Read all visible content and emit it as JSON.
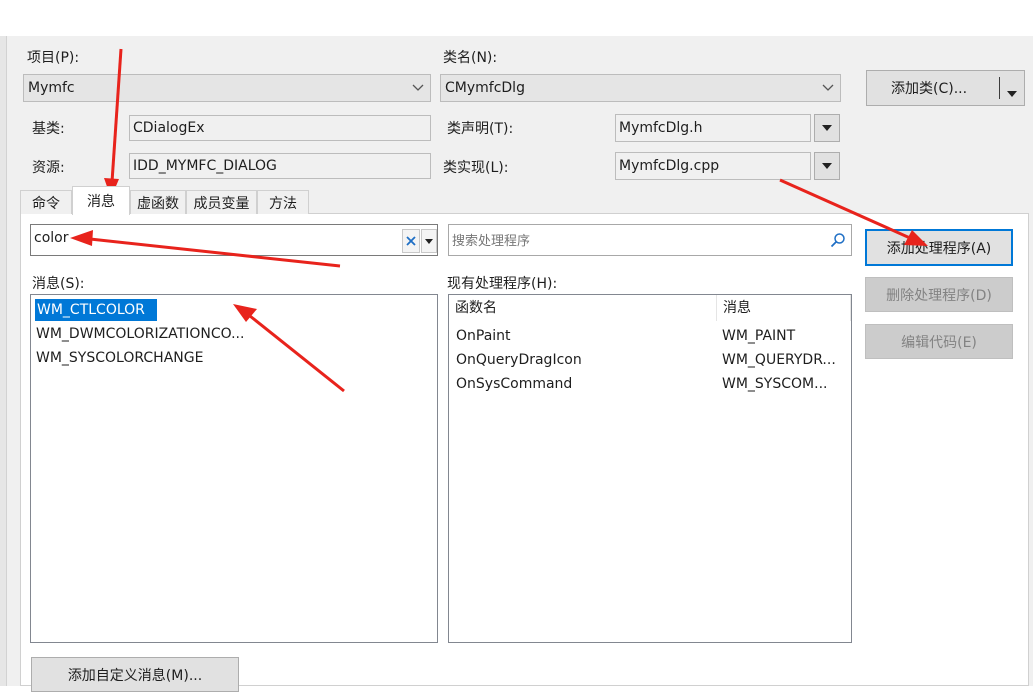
{
  "labels": {
    "project": "项目(P):",
    "class_name": "类名(N):",
    "base_class": "基类:",
    "resource": "资源:",
    "class_decl": "类声明(T):",
    "class_impl": "类实现(L):",
    "messages": "消息(S):",
    "handlers": "现有处理程序(H):"
  },
  "project_combo": {
    "value": "Mymfc"
  },
  "class_combo": {
    "value": "CMymfcDlg"
  },
  "base_class_value": "CDialogEx",
  "resource_value": "IDD_MYMFC_DIALOG",
  "class_decl_value": "MymfcDlg.h",
  "class_impl_value": "MymfcDlg.cpp",
  "add_class_button": "添加类(C)...",
  "tabs": [
    "命令",
    "消息",
    "虚函数",
    "成员变量",
    "方法"
  ],
  "filter": {
    "value": "color"
  },
  "search": {
    "placeholder": "搜索处理程序"
  },
  "messages": [
    "WM_CTLCOLOR",
    "WM_DWMCOLORIZATIONCO...",
    "WM_SYSCOLORCHANGE"
  ],
  "handlers_table": {
    "columns": [
      "函数名",
      "消息"
    ],
    "rows": [
      [
        "OnPaint",
        "WM_PAINT"
      ],
      [
        "OnQueryDragIcon",
        "WM_QUERYDR..."
      ],
      [
        "OnSysCommand",
        "WM_SYSCOM..."
      ]
    ]
  },
  "buttons": {
    "add_handler": "添加处理程序(A)",
    "delete_handler": "删除处理程序(D)",
    "edit_code": "编辑代码(E)",
    "add_custom_message": "添加自定义消息(M)..."
  },
  "colors": {
    "selection": "#0078d7",
    "annotation_arrow": "#e8231c"
  }
}
